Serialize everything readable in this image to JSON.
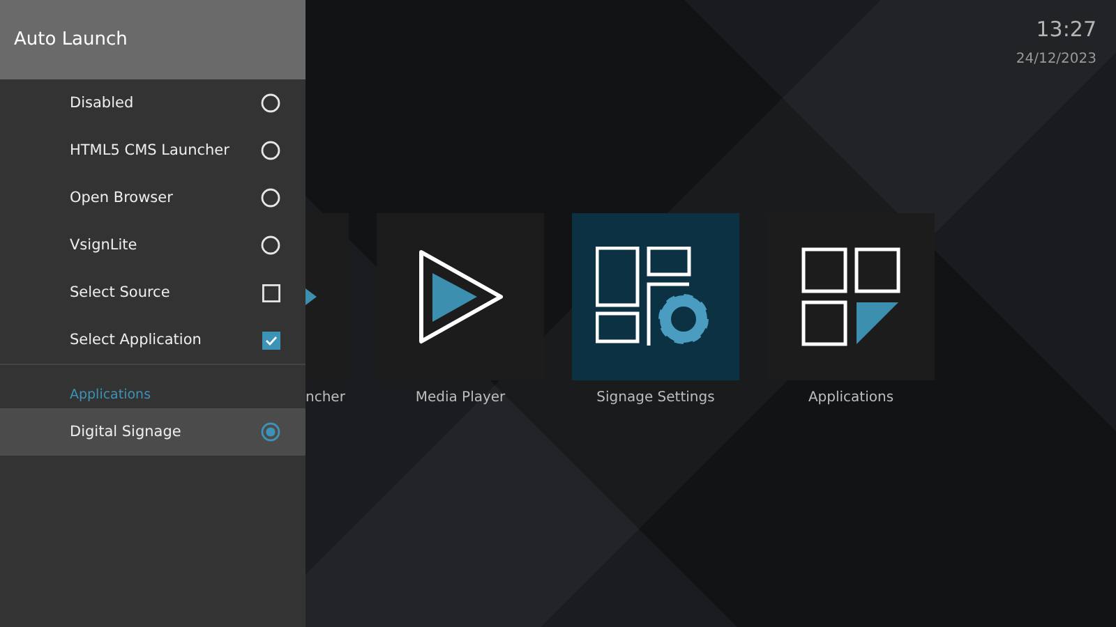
{
  "drawer": {
    "title": "Auto Launch",
    "items": [
      {
        "label": "Disabled",
        "kind": "radio",
        "checked": false
      },
      {
        "label": "HTML5 CMS Launcher",
        "kind": "radio",
        "checked": false
      },
      {
        "label": "Open Browser",
        "kind": "radio",
        "checked": false
      },
      {
        "label": "VsignLite",
        "kind": "radio",
        "checked": false
      },
      {
        "label": "Select Source",
        "kind": "checkbox",
        "checked": false
      },
      {
        "label": "Select Application",
        "kind": "checkbox",
        "checked": true
      }
    ],
    "section": "Applications",
    "apps": [
      {
        "label": "Digital Signage",
        "kind": "radio",
        "checked": true,
        "selected": true
      }
    ]
  },
  "clock": {
    "time": "13:27",
    "date": "24/12/2023"
  },
  "tiles": [
    {
      "label": "ncher",
      "kind": "partial",
      "selected": false
    },
    {
      "label": "Media Player",
      "kind": "play",
      "selected": false
    },
    {
      "label": "Signage Settings",
      "kind": "signage",
      "selected": true
    },
    {
      "label": "Applications",
      "kind": "apps",
      "selected": false
    }
  ]
}
